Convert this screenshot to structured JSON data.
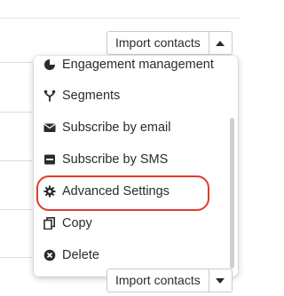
{
  "toolbar_top": {
    "import_label": "Import contacts"
  },
  "toolbar_bottom": {
    "import_label": "Import contacts"
  },
  "menu": {
    "items": [
      {
        "label": "Engagement management",
        "icon": "pie-chart-icon"
      },
      {
        "label": "Segments",
        "icon": "branch-icon"
      },
      {
        "label": "Subscribe by email",
        "icon": "envelope-icon"
      },
      {
        "label": "Subscribe by SMS",
        "icon": "sms-icon"
      },
      {
        "label": "Advanced Settings",
        "icon": "gear-icon",
        "highlighted": true
      },
      {
        "label": "Copy",
        "icon": "copy-icon"
      },
      {
        "label": "Delete",
        "icon": "delete-circle-icon"
      }
    ]
  },
  "colors": {
    "highlight": "#e03b2a",
    "text": "#2b2b2b",
    "border": "#c9c9c9"
  }
}
